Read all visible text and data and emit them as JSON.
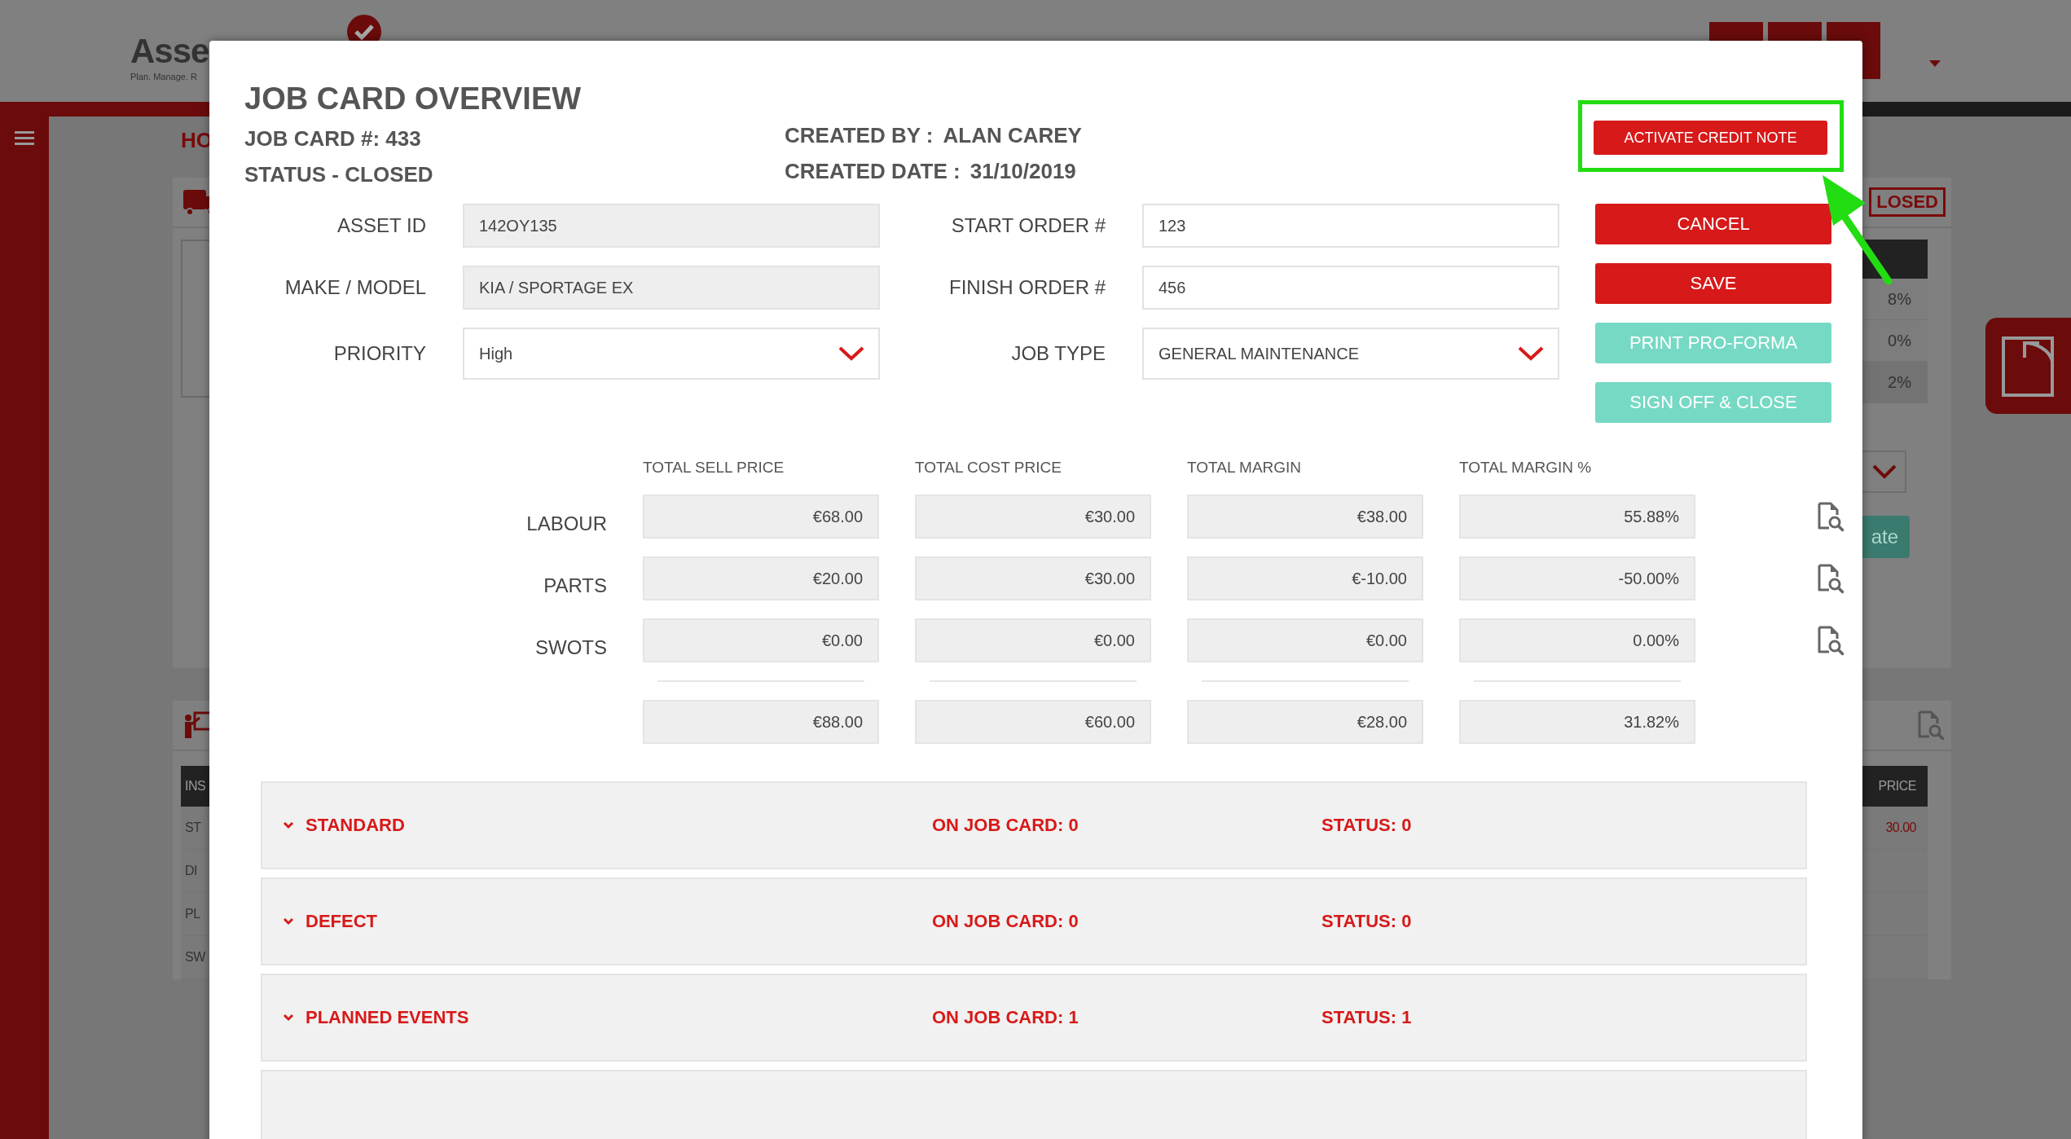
{
  "background": {
    "logo": "Asse",
    "tagline": "Plan. Manage. R",
    "breadcrumb": "HO",
    "status_badge": "LOSED",
    "percent_rows": [
      "8%",
      "0%",
      "2%"
    ],
    "action_button": "ate",
    "table": {
      "columns": [
        "INS",
        "PRICE"
      ],
      "rows": [
        {
          "cells": [
            "ST",
            "30.00"
          ]
        },
        {
          "cells": [
            "DI"
          ]
        },
        {
          "cells": [
            "PL"
          ]
        },
        {
          "cells": [
            "SW"
          ]
        }
      ]
    }
  },
  "modal": {
    "title": "JOB CARD OVERVIEW",
    "job_card": "JOB CARD #: 433",
    "status": "STATUS - CLOSED",
    "created_by": {
      "label": "CREATED BY :",
      "value": "ALAN CAREY"
    },
    "created_date": {
      "label": "CREATED DATE :",
      "value": "31/10/2019"
    },
    "credit_note_button": "ACTIVATE CREDIT NOTE",
    "fields": [
      {
        "label": "ASSET ID",
        "value": "142OY135",
        "kind": "readonly"
      },
      {
        "label": "START ORDER #",
        "value": "123",
        "kind": "text"
      },
      {
        "label": "MAKE / MODEL",
        "value": "KIA / SPORTAGE EX",
        "kind": "readonly"
      },
      {
        "label": "FINISH ORDER #",
        "value": "456",
        "kind": "text"
      },
      {
        "label": "PRIORITY",
        "value": "High",
        "kind": "select"
      },
      {
        "label": "JOB TYPE",
        "value": "GENERAL MAINTENANCE",
        "kind": "select"
      }
    ],
    "actions": [
      {
        "label": "CANCEL",
        "kind": "primary"
      },
      {
        "label": "SAVE",
        "kind": "primary"
      },
      {
        "label": "PRINT PRO-FORMA",
        "kind": "secondary"
      },
      {
        "label": "SIGN OFF & CLOSE",
        "kind": "secondary"
      }
    ],
    "totals": {
      "columns": [
        "TOTAL SELL PRICE",
        "TOTAL COST PRICE",
        "TOTAL MARGIN",
        "TOTAL MARGIN %"
      ],
      "rows": [
        {
          "label": "LABOUR",
          "values": [
            "€68.00",
            "€30.00",
            "€38.00",
            "55.88%"
          ]
        },
        {
          "label": "PARTS",
          "values": [
            "€20.00",
            "€30.00",
            "€-10.00",
            "-50.00%"
          ]
        },
        {
          "label": "SWOTS",
          "values": [
            "€0.00",
            "€0.00",
            "€0.00",
            "0.00%"
          ]
        }
      ],
      "sum": [
        "€88.00",
        "€60.00",
        "€28.00",
        "31.82%"
      ]
    },
    "sections": [
      {
        "title": "STANDARD",
        "on_job_card": "ON JOB CARD: 0",
        "status": "STATUS: 0"
      },
      {
        "title": "DEFECT",
        "on_job_card": "ON JOB CARD: 0",
        "status": "STATUS: 0"
      },
      {
        "title": "PLANNED EVENTS",
        "on_job_card": "ON JOB CARD: 1",
        "status": "STATUS: 1"
      }
    ]
  }
}
